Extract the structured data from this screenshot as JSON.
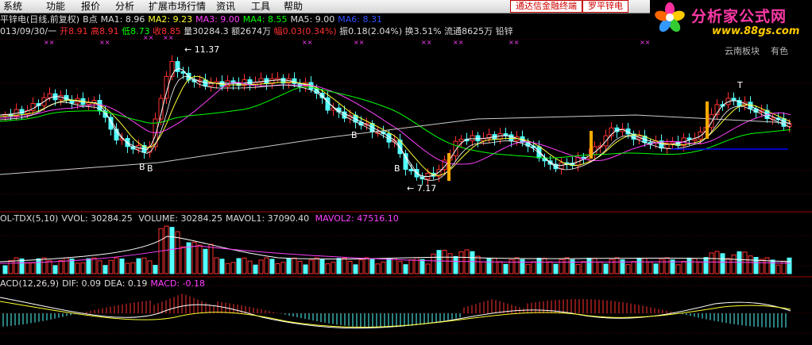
{
  "menu": [
    "系统",
    "功能",
    "报价",
    "分析",
    "扩展市场行情",
    "资讯",
    "工具",
    "帮助"
  ],
  "top_links": {
    "terminal": "通达信金融终端",
    "stock": "罗平锌电"
  },
  "logo": {
    "title": "分析家公式网",
    "url": "www.88gs.com"
  },
  "colors": {
    "red": "#ff3030",
    "cyan": "#54ffff",
    "white": "#ffffff",
    "yellow": "#ffff33",
    "magenta": "#ff40ff",
    "green": "#00ff00",
    "blue": "#0000ff",
    "ma_title_blue": "#3050ff",
    "orange": "#ffaa00"
  },
  "title_line": {
    "name": "平锌电(日线,前复权)",
    "type": "B点",
    "ma1": "MA1: 8.96",
    "ma2": "MA2: 9.23",
    "ma3": "MA3: 9.00",
    "ma4": "MA4: 8.55",
    "ma5": "MA5: 9.00",
    "ma6": "MA6: 8.31"
  },
  "info_line": {
    "date": "013/09/30/一",
    "open": "开8.91",
    "high": "高8.91",
    "low": "低8.73",
    "close": "收8.85",
    "volume": "量30284.3",
    "amount": "额2674万",
    "change": "幅0.03(0.34%)",
    "amplitude": "振0.18(2.04%)",
    "turnover": "换3.51%",
    "float_shares": "流通8625万",
    "sector": "铅锌"
  },
  "side_labels": {
    "region": "云南板块",
    "nonferrous": "有色"
  },
  "annotations": {
    "high": "11.37",
    "low": "7.17",
    "buy": "B",
    "x": "××",
    "signal_mark": "↑"
  },
  "vol_panel": {
    "name": "OL-TDX(5,10)",
    "vvol": "VVOL: 30284.25",
    "volume": "VOLUME: 30284.25",
    "mavol1": "MAVOL1: 37090.40",
    "mavol2": "MAVOL2: 47516.10"
  },
  "macd_panel": {
    "name": "ACD(12,26,9)",
    "dif": "DIF: 0.09",
    "dea": "DEA: 0.19",
    "macd": "MACD: -0.18"
  }
}
